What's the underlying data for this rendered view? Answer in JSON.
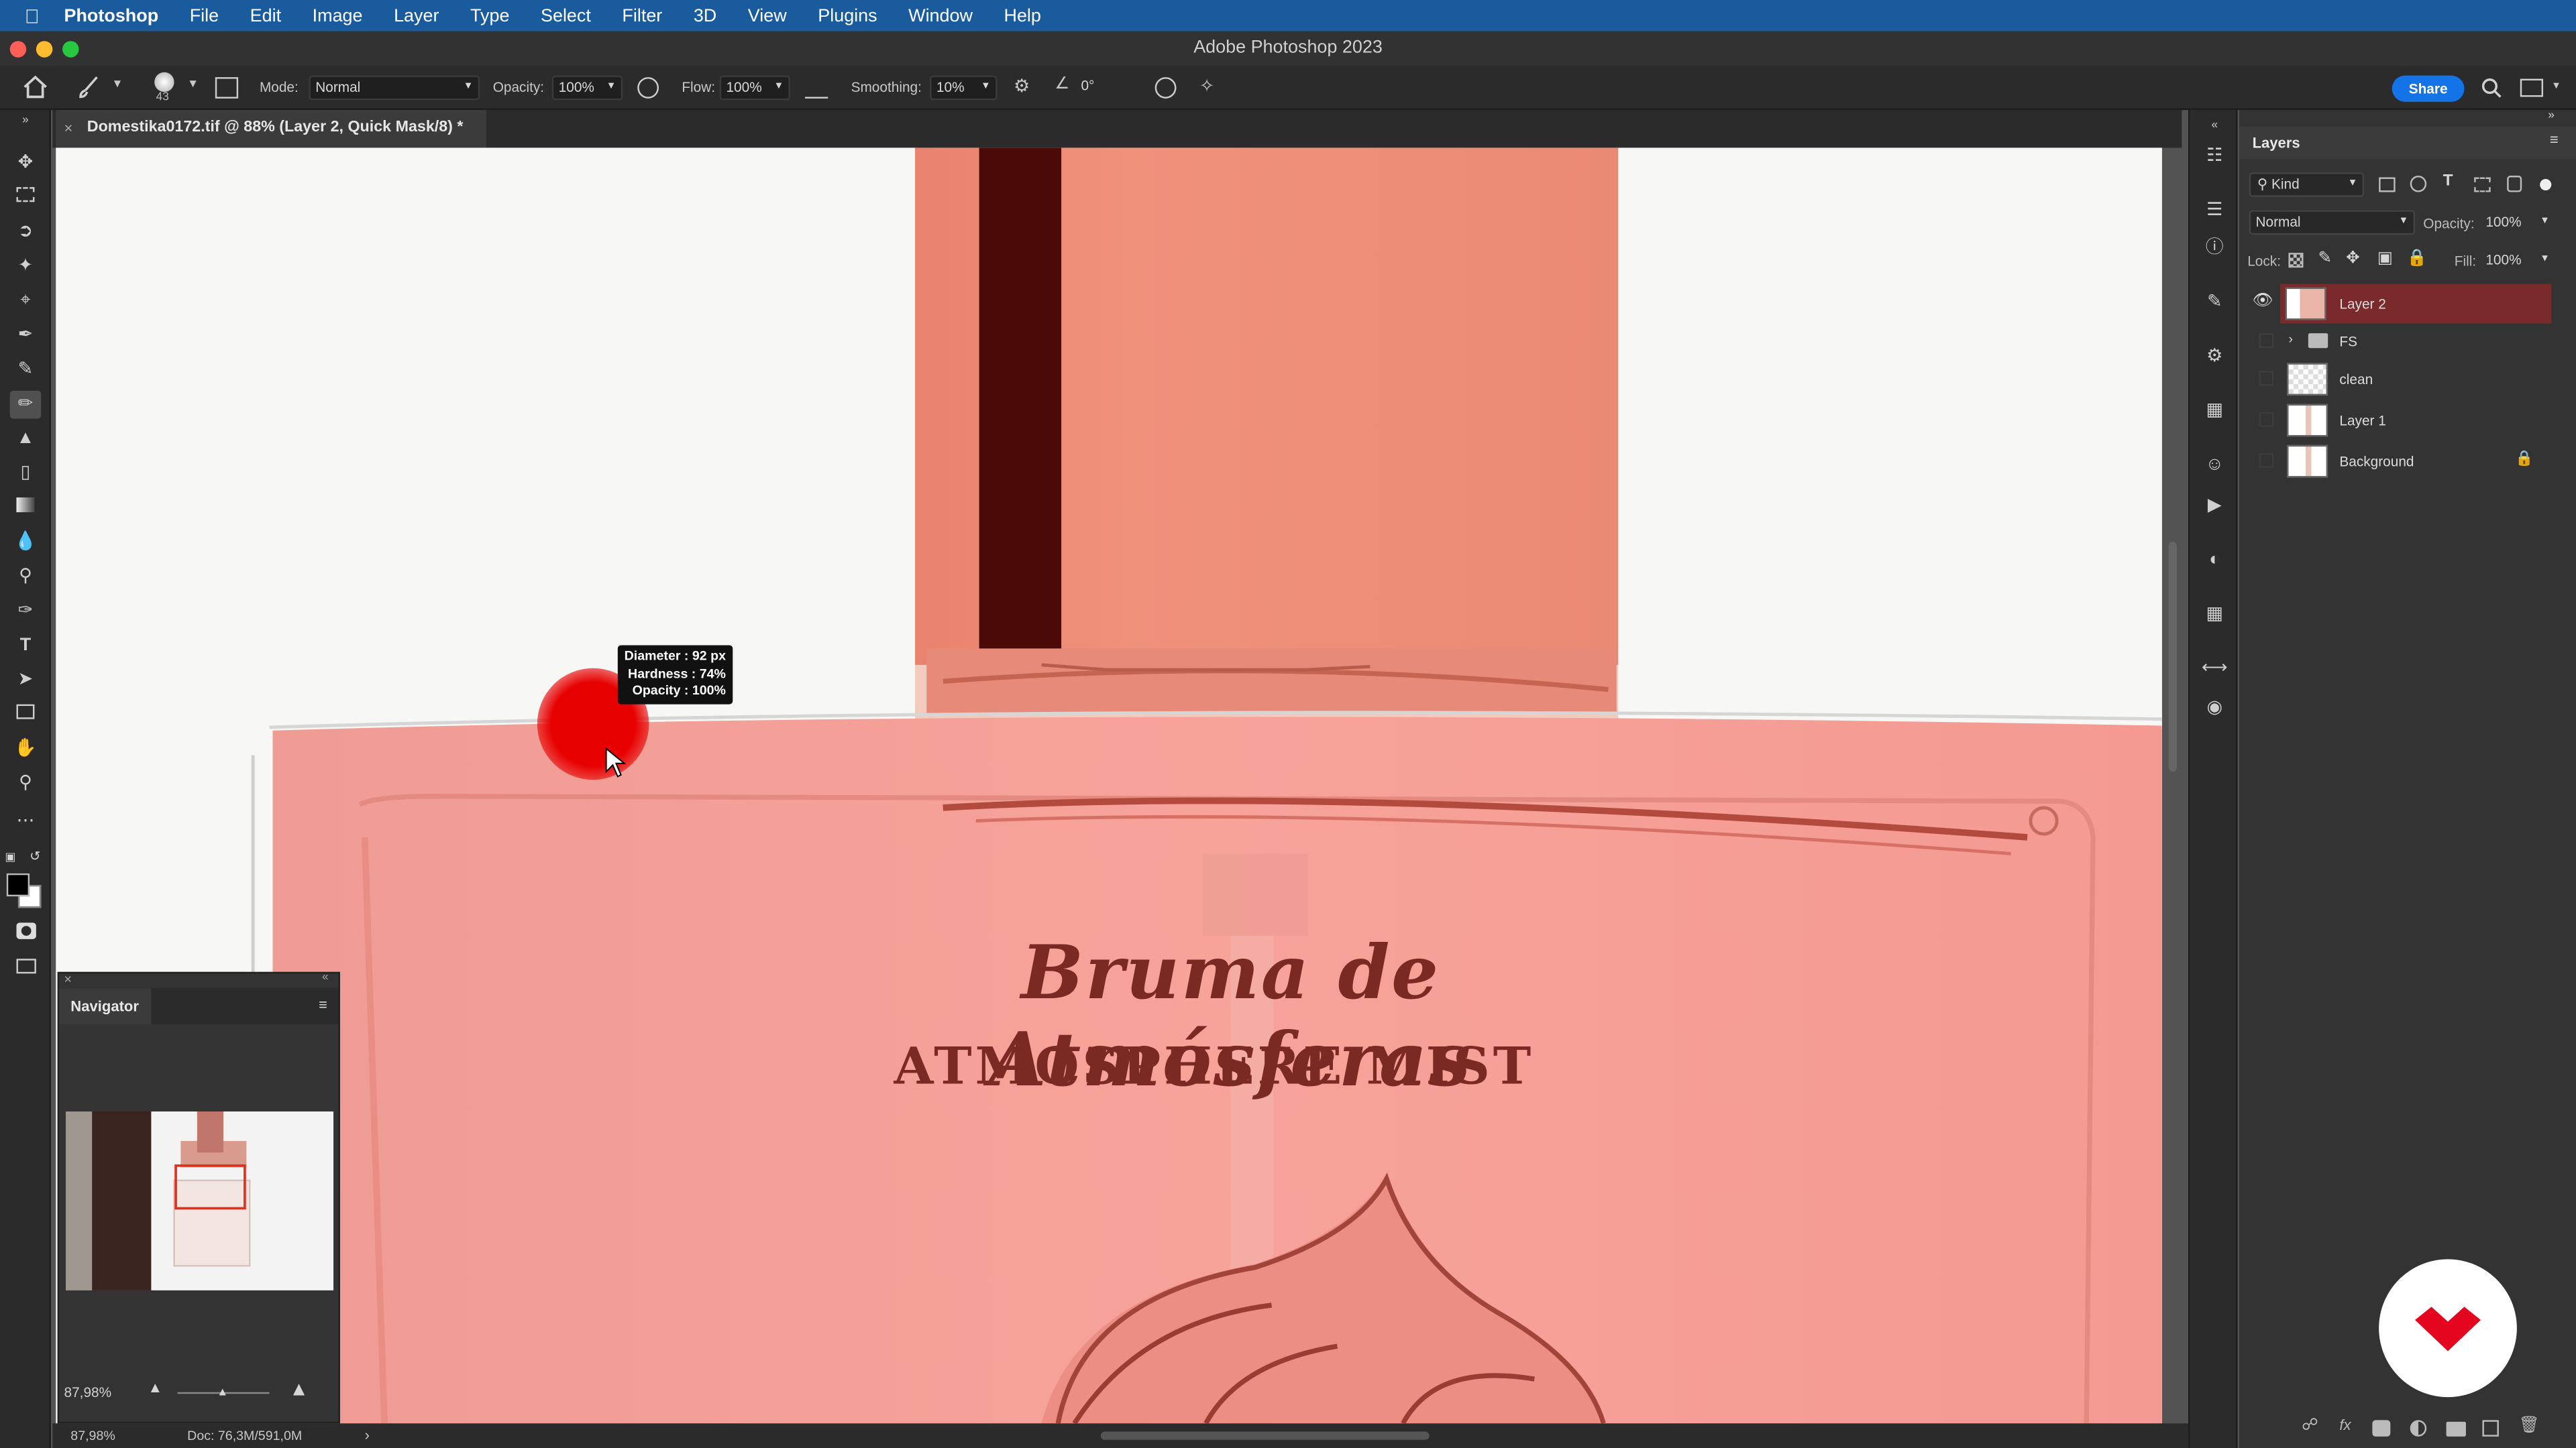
{
  "menubar": {
    "app": "Photoshop",
    "items": [
      "File",
      "Edit",
      "Image",
      "Layer",
      "Type",
      "Select",
      "Filter",
      "3D",
      "View",
      "Plugins",
      "Window",
      "Help"
    ]
  },
  "window": {
    "title": "Adobe Photoshop 2023"
  },
  "options": {
    "brush_size": "43",
    "mode_label": "Mode:",
    "mode_value": "Normal",
    "opacity_label": "Opacity:",
    "opacity_value": "100%",
    "flow_label": "Flow:",
    "flow_value": "100%",
    "smoothing_label": "Smoothing:",
    "smoothing_value": "10%",
    "angle_value": "0°",
    "share_label": "Share"
  },
  "document": {
    "tab_title": "Domestika0172.tif @ 88% (Layer 2, Quick Mask/8) *"
  },
  "canvas": {
    "text_line1": "Bruma de Atmósferas",
    "text_line2": "ATMOSPHERE MIST",
    "tooltip": {
      "diameter": "Diameter : 92 px",
      "hardness": "Hardness :  74%",
      "opacity": "Opacity : 100%"
    },
    "quick_mask_color": "#e8332e"
  },
  "layers_panel": {
    "title": "Layers",
    "filter_label": "Kind",
    "blend_mode": "Normal",
    "opacity_label": "Opacity:",
    "opacity_value": "100%",
    "lock_label": "Lock:",
    "fill_label": "Fill:",
    "fill_value": "100%",
    "layers": [
      {
        "name": "Layer 2",
        "visible": true,
        "selected": true
      },
      {
        "name": "FS",
        "type": "group"
      },
      {
        "name": "clean"
      },
      {
        "name": "Layer 1"
      },
      {
        "name": "Background",
        "locked": true
      }
    ]
  },
  "navigator": {
    "title": "Navigator",
    "zoom_value": "87,98%"
  },
  "status": {
    "zoom": "87,98%",
    "doc": "Doc: 76,3M/591,0M"
  },
  "colors": {
    "selection": "#7a2a2a",
    "accent": "#1473e6",
    "brand_red": "#e4051f"
  }
}
